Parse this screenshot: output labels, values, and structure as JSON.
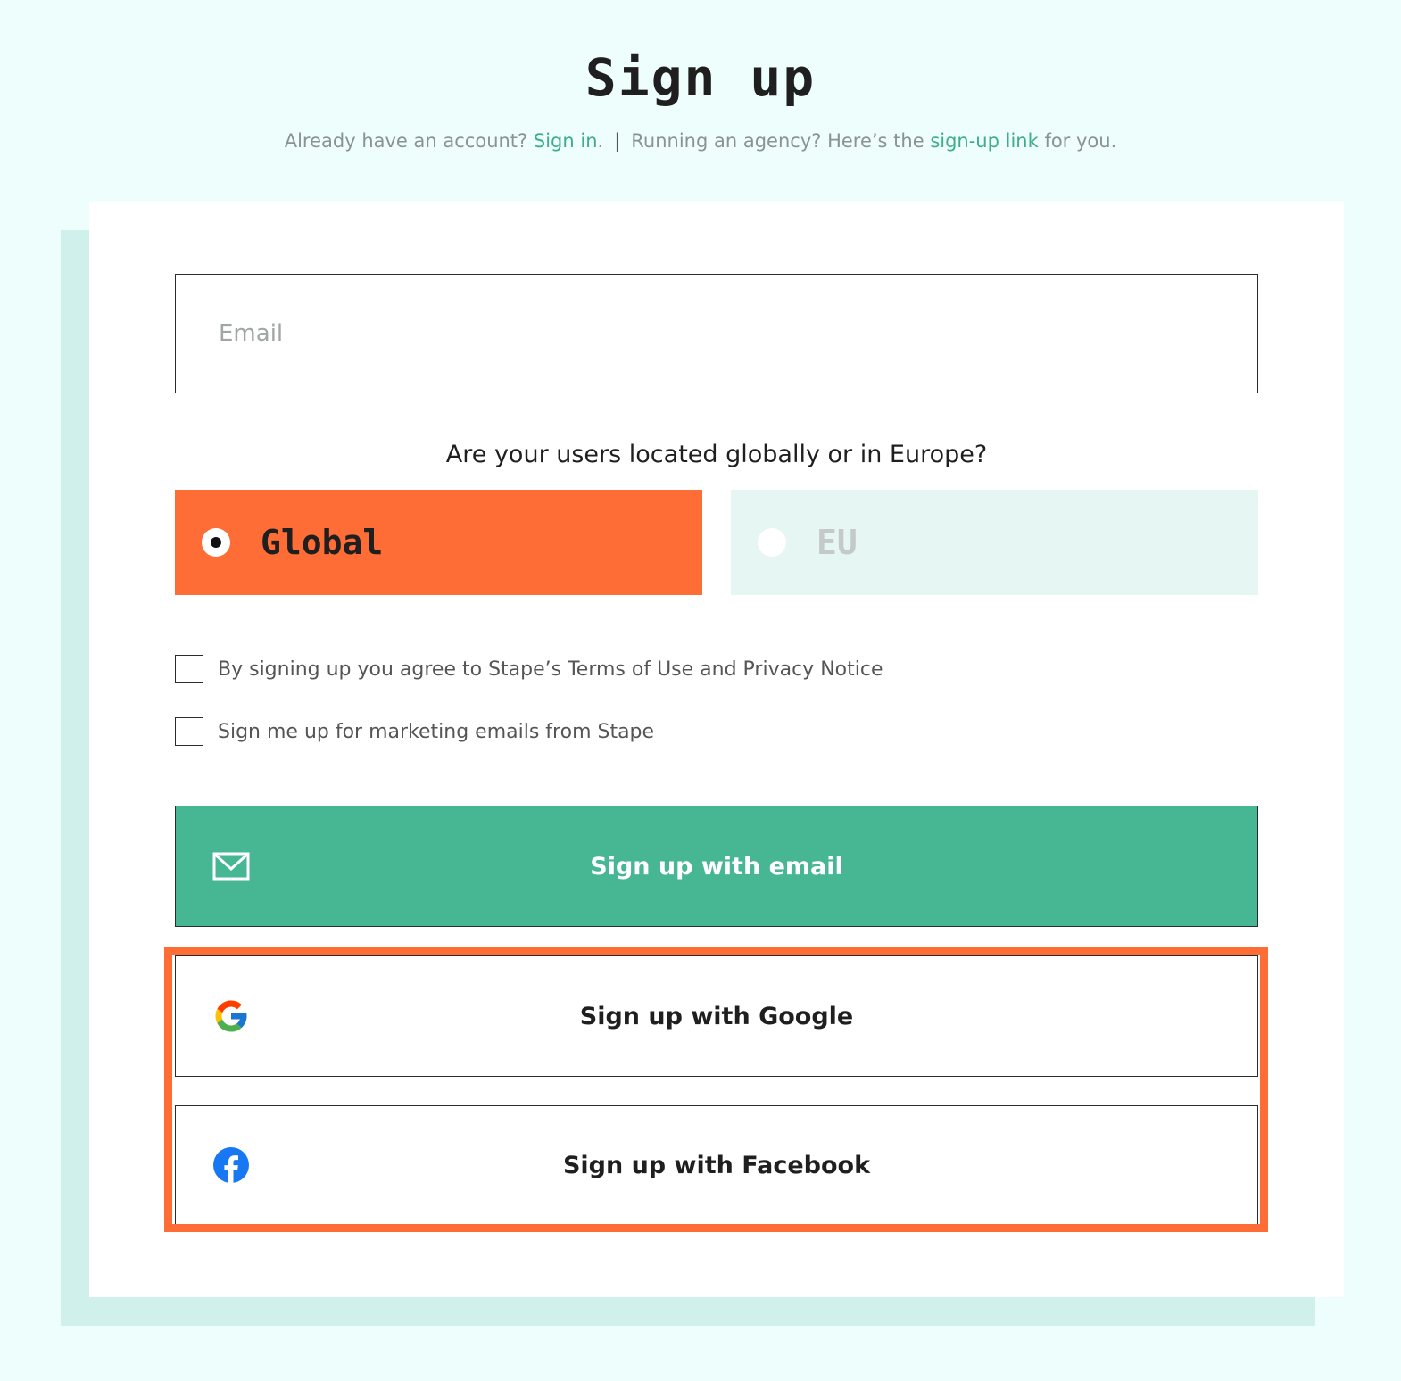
{
  "header": {
    "title": "Sign up",
    "subtitle": {
      "account_prefix": "Already have an account? ",
      "sign_in_link": "Sign in",
      "account_suffix": ".",
      "separator": "|",
      "agency_prefix": "Running an agency? Here’s the ",
      "agency_link": "sign-up link",
      "agency_suffix": " for you."
    }
  },
  "form": {
    "email_placeholder": "Email",
    "region_question": "Are your users located globally or in Europe?",
    "regions": [
      {
        "label": "Global",
        "selected": true
      },
      {
        "label": "EU",
        "selected": false
      }
    ],
    "checkboxes": [
      {
        "label": "By signing up you agree to Stape’s Terms of Use and Privacy Notice",
        "checked": false
      },
      {
        "label": "Sign me up for marketing emails from Stape",
        "checked": false
      }
    ],
    "buttons": {
      "email": {
        "label": "Sign up with email",
        "icon": "mail-icon"
      },
      "google": {
        "label": "Sign up with Google",
        "icon": "google-icon"
      },
      "facebook": {
        "label": "Sign up with Facebook",
        "icon": "facebook-icon"
      }
    }
  },
  "colors": {
    "background": "#edfefc",
    "card_shadow": "#d0f0eb",
    "accent_orange": "#ff6d37",
    "accent_green": "#47b693",
    "link_green": "#3fae88",
    "eu_option_bg": "#e6f6f2",
    "facebook_blue": "#1877f2"
  }
}
